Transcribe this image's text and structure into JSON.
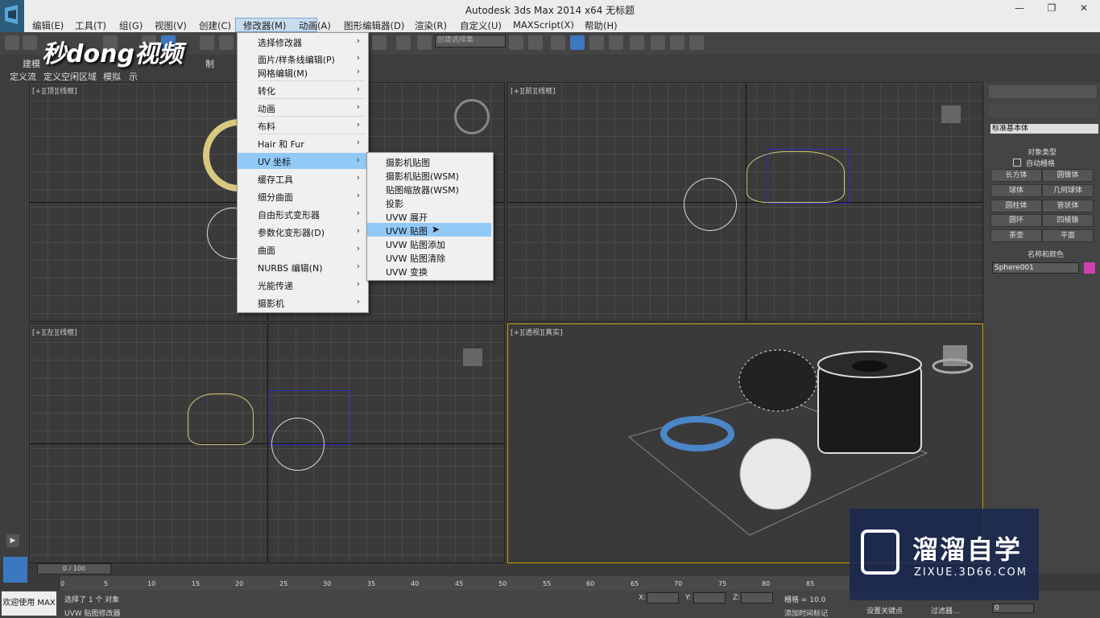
{
  "window": {
    "title": "Autodesk 3ds Max  2014 x64     无标题",
    "min": "—",
    "max": "❐",
    "close": "✕"
  },
  "menubar": [
    "编辑(E)",
    "工具(T)",
    "组(G)",
    "视图(V)",
    "创建(C)",
    "修改器(M)",
    "动画(A)",
    "图形编辑器(D)",
    "渲染(R)",
    "自定义(U)",
    "MAXScript(X)",
    "帮助(H)"
  ],
  "toolbar": {
    "selection_set": "创建选择集"
  },
  "ribbon": {
    "row1": [
      "建模",
      "制"
    ],
    "row2": [
      "定义流",
      "定义空闲区域",
      "模拟",
      "示"
    ]
  },
  "modifiers_menu": {
    "items": [
      {
        "label": "选择修改器",
        "arrow": "›"
      },
      {
        "label": "面片/样条线编辑(P)",
        "arrow": "›"
      },
      {
        "label": "网格编辑(M)",
        "arrow": "›"
      },
      {
        "label": "转化",
        "arrow": "›"
      },
      {
        "label": "动画",
        "arrow": "›"
      },
      {
        "label": "布料",
        "arrow": "›"
      },
      {
        "label": "Hair 和 Fur",
        "arrow": "›"
      },
      {
        "label": "UV 坐标",
        "arrow": "›"
      },
      {
        "label": "缓存工具",
        "arrow": "›"
      },
      {
        "label": "细分曲面",
        "arrow": "›"
      },
      {
        "label": "自由形式变形器",
        "arrow": "›"
      },
      {
        "label": "参数化变形器(D)",
        "arrow": "›"
      },
      {
        "label": "曲面",
        "arrow": "›"
      },
      {
        "label": "NURBS 编辑(N)",
        "arrow": "›"
      },
      {
        "label": "光能传递",
        "arrow": "›"
      },
      {
        "label": "摄影机",
        "arrow": "›"
      }
    ],
    "highlighted": "UV 坐标"
  },
  "uv_submenu": {
    "items": [
      "摄影机贴图",
      "摄影机贴图(WSM)",
      "贴图缩放器(WSM)",
      "投影",
      "UVW 展开",
      "UVW 贴图",
      "UVW 贴图添加",
      "UVW 贴图清除",
      "UVW 变换"
    ],
    "highlighted": "UVW 贴图"
  },
  "viewports": {
    "top": "[+][顶][线框]",
    "front": "[+][前][线框]",
    "left": "[+][左][线框]",
    "persp": "[+][透视][真实]"
  },
  "command_panel": {
    "dropdown": "标准基本体",
    "rollout_type": "对象类型",
    "autogrid": "自动栅格",
    "buttons": [
      "长方体",
      "圆锥体",
      "球体",
      "几何球体",
      "圆柱体",
      "管状体",
      "圆环",
      "四棱锥",
      "茶壶",
      "平面"
    ],
    "rollout_name": "名称和颜色",
    "object_name": "Sphere001",
    "object_color": "#d040b0"
  },
  "timeline": {
    "frame": "0 / 100",
    "ticks": [
      "0",
      "5",
      "10",
      "15",
      "20",
      "25",
      "30",
      "35",
      "40",
      "45",
      "50",
      "55",
      "60",
      "65",
      "70",
      "75",
      "80",
      "85"
    ]
  },
  "statusbar": {
    "welcome": "欢迎使用 MAX",
    "selected": "选择了 1 个 对象",
    "prompt": "UVW 贴图修改器",
    "x_label": "X:",
    "y_label": "Y:",
    "z_label": "Z:",
    "grid": "栅格 = 10.0",
    "add_time_tag": "添加时间标记",
    "set_key": "设置关键点",
    "filters": "过滤器...",
    "frame_field": "0"
  },
  "watermarks": {
    "left": "秒dong视频",
    "right_big": "溜溜自学",
    "right_small": "ZIXUE.3D66.COM"
  }
}
